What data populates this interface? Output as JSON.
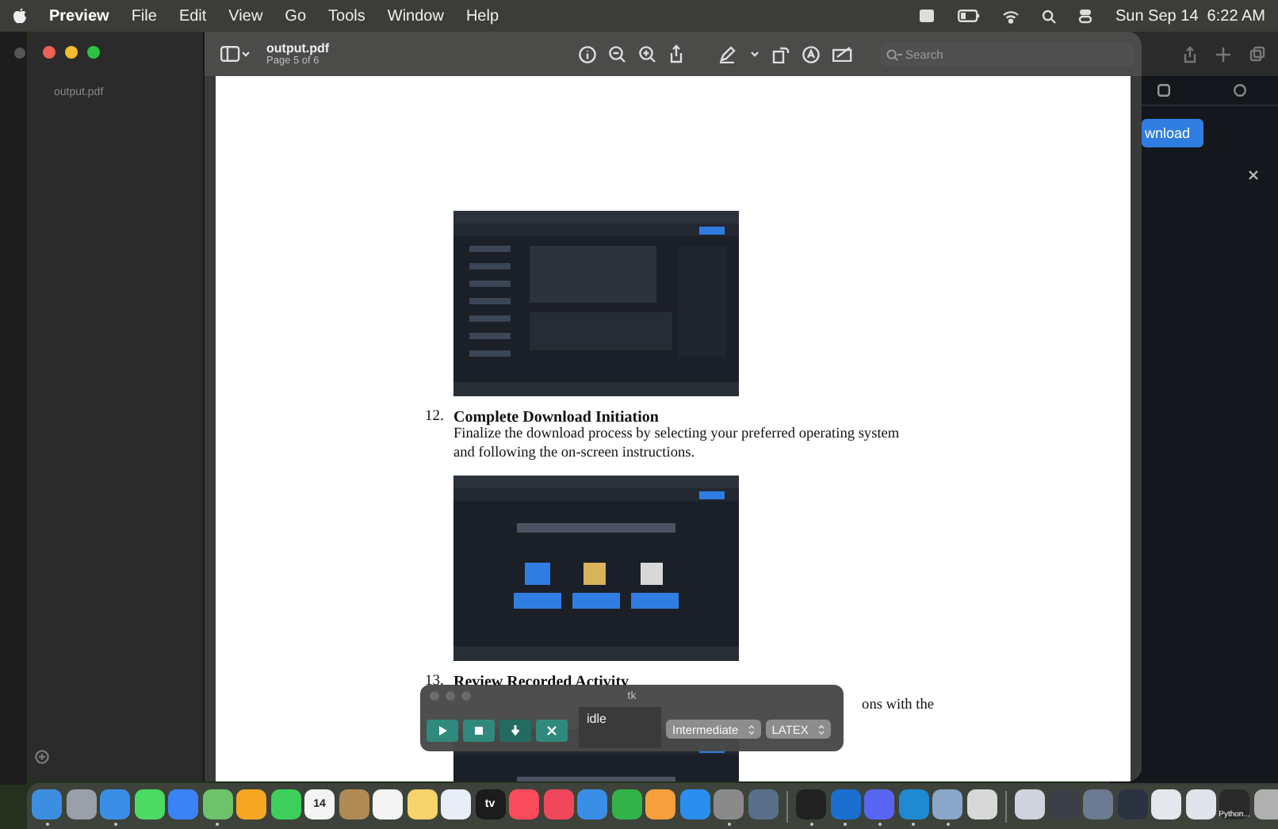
{
  "menu_bar": {
    "app": "Preview",
    "menus": [
      "File",
      "Edit",
      "View",
      "Go",
      "Tools",
      "Window",
      "Help"
    ],
    "clock": "Sun Sep 14  6:22 AM"
  },
  "window": {
    "title": "output.pdf",
    "subtitle": "Page 5 of 6",
    "search": {
      "placeholder": "Search"
    }
  },
  "sidebar": {
    "items": [
      {
        "label": "output.pdf"
      }
    ]
  },
  "document": {
    "items": [
      {
        "kind": "picture"
      },
      {
        "kind": "step",
        "number": "12.",
        "title": "Complete Download Initiation",
        "text": "Finalize the download process by selecting your preferred operating system and following the on-screen instructions."
      },
      {
        "kind": "picture"
      },
      {
        "kind": "covered_step",
        "number": "13.",
        "title": "Review Recorded Activity",
        "text": "ons with the"
      },
      {
        "kind": "picture"
      }
    ]
  },
  "tk_panel": {
    "title": "tk",
    "buttons": [
      {
        "kind": "play"
      },
      {
        "kind": "stop"
      },
      {
        "kind": "download"
      },
      {
        "kind": "close"
      }
    ],
    "status": "idle",
    "selects": [
      "Intermediate",
      "LATEX"
    ]
  },
  "back_window": {
    "button": "wnload"
  },
  "dock": {
    "groups": [
      [
        {
          "color": "#3d8ee0",
          "running": true
        },
        {
          "color": "#9aa0a8",
          "running": false
        },
        {
          "color": "#3a8ee6",
          "running": true
        },
        {
          "color": "#4cd964",
          "running": false
        },
        {
          "color": "#3b82f6",
          "running": false
        },
        {
          "color": "#6cc36b",
          "running": true
        },
        {
          "color": "#f5a623",
          "running": false
        },
        {
          "color": "#3ecf5a",
          "running": false
        },
        {
          "color": "#f4f4f4",
          "running": false,
          "label": "14"
        },
        {
          "color": "#b08a55",
          "running": false
        },
        {
          "color": "#f4f4f4",
          "running": false
        },
        {
          "color": "#f7d36b",
          "running": false
        },
        {
          "color": "#e8eef8",
          "running": false
        },
        {
          "color": "#1c1c1c",
          "running": false,
          "label": "tv"
        },
        {
          "color": "#fa4b5c",
          "running": false
        },
        {
          "color": "#f0485a",
          "running": false
        },
        {
          "color": "#3b8ee6",
          "running": false
        },
        {
          "color": "#33b24a",
          "running": false
        },
        {
          "color": "#f5a03c",
          "running": false
        },
        {
          "color": "#2a8ef0",
          "running": false
        },
        {
          "color": "#8a8a8a",
          "running": true
        },
        {
          "color": "#5a6f8a",
          "running": false
        }
      ],
      [
        {
          "color": "#222222",
          "running": true
        },
        {
          "color": "#1a6fd1",
          "running": true
        },
        {
          "color": "#5865f2",
          "running": true
        },
        {
          "color": "#1f8ad2",
          "running": true
        },
        {
          "color": "#8aa6c8",
          "running": true
        },
        {
          "color": "#d8d8d8",
          "running": false
        }
      ],
      [
        {
          "color": "#cfd4dc",
          "running": false
        },
        {
          "color": "#3a3f48",
          "running": false
        },
        {
          "color": "#6b7a90",
          "running": false
        },
        {
          "color": "#2b3340",
          "running": false
        },
        {
          "color": "#e4e8ee",
          "running": false
        },
        {
          "color": "#dfe3ea",
          "running": false
        },
        {
          "color": "#2a2a2a",
          "running": false,
          "label": "Python..."
        },
        {
          "color": "#b0b0b0",
          "running": false
        }
      ]
    ]
  }
}
